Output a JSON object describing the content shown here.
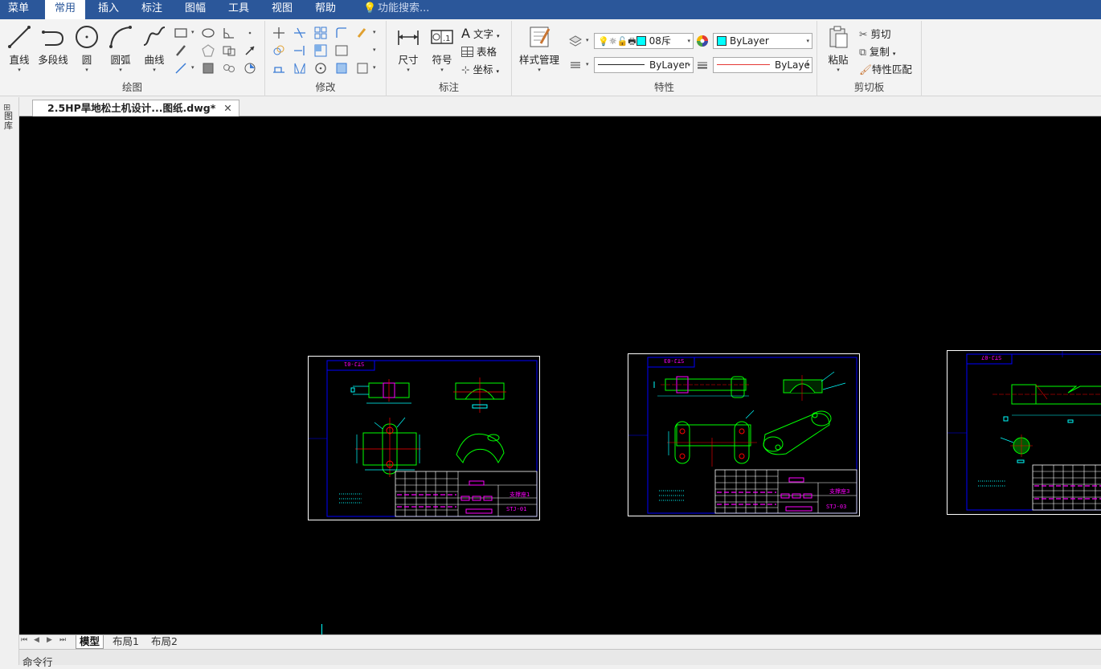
{
  "menubar": {
    "items": [
      "菜单",
      "常用",
      "插入",
      "标注",
      "图幅",
      "工具",
      "视图",
      "帮助"
    ],
    "active": "常用",
    "search_placeholder": "功能搜索..."
  },
  "ribbon": {
    "draw": {
      "label": "绘图",
      "line": "直线",
      "polyline": "多段线",
      "circle": "圆",
      "arc": "圆弧",
      "curve": "曲线"
    },
    "modify": {
      "label": "修改"
    },
    "annotate": {
      "label": "标注",
      "dimension": "尺寸",
      "symbol": "符号",
      "text": "文字",
      "table": "表格",
      "coord": "坐标"
    },
    "properties": {
      "label": "特性",
      "style_manager": "样式管理",
      "layer_value": "08斥",
      "color_value": "ByLayer",
      "linetype_value": "ByLayer",
      "lineweight_value": "ByLayé"
    },
    "clipboard": {
      "label": "剪切板",
      "paste": "粘贴",
      "cut": "剪切",
      "copy": "复制",
      "match": "特性匹配"
    }
  },
  "left_strip": {
    "label": "图库"
  },
  "document": {
    "tab_title": "2.5HP旱地松土机设计...图纸.dwg*",
    "close_icon": "close-icon"
  },
  "drawings": [
    {
      "header_tag": "STJ-01",
      "title_name": "支撑座1",
      "drawing_no": "STJ-01"
    },
    {
      "header_tag": "STJ-03",
      "title_name": "支撑座3",
      "drawing_no": "STJ-03"
    },
    {
      "header_tag": "STJ-07",
      "title_name": "",
      "drawing_no": ""
    }
  ],
  "layout_tabs": {
    "model": "模型",
    "layout1": "布局1",
    "layout2": "布局2"
  },
  "command": {
    "label": "命令行"
  },
  "colors": {
    "menubar": "#2b579a",
    "canvas": "#000000",
    "drawing_border": "#0000ff",
    "drawing_green": "#00ff00",
    "drawing_magenta": "#ff00ff",
    "drawing_red": "#ff0000",
    "drawing_cyan": "#00ffff"
  }
}
